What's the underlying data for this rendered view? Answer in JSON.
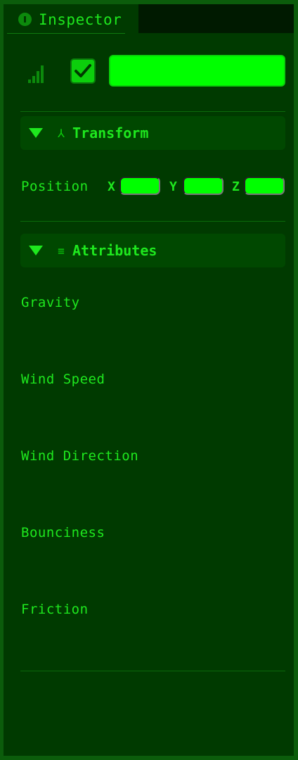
{
  "panel": {
    "tab_title": "Inspector",
    "name_value": "",
    "enabled": true
  },
  "transform": {
    "title": "Transform",
    "position_label": "Position",
    "axes": [
      {
        "label": "X",
        "value": ""
      },
      {
        "label": "Y",
        "value": ""
      },
      {
        "label": "Z",
        "value": ""
      }
    ]
  },
  "attributes": {
    "title": "Attributes",
    "items": [
      {
        "label": "Gravity"
      },
      {
        "label": "Wind Speed"
      },
      {
        "label": "Wind Direction"
      },
      {
        "label": "Bounciness"
      },
      {
        "label": "Friction"
      }
    ]
  },
  "colors": {
    "background": "#003a00",
    "accent": "#00ff00",
    "text": "#1ee81e"
  },
  "icons": {
    "tab": "info-icon",
    "status": "signal-icon",
    "transform": "transform-axes-icon",
    "attributes": "sliders-icon",
    "fold": "triangle-down-icon"
  }
}
